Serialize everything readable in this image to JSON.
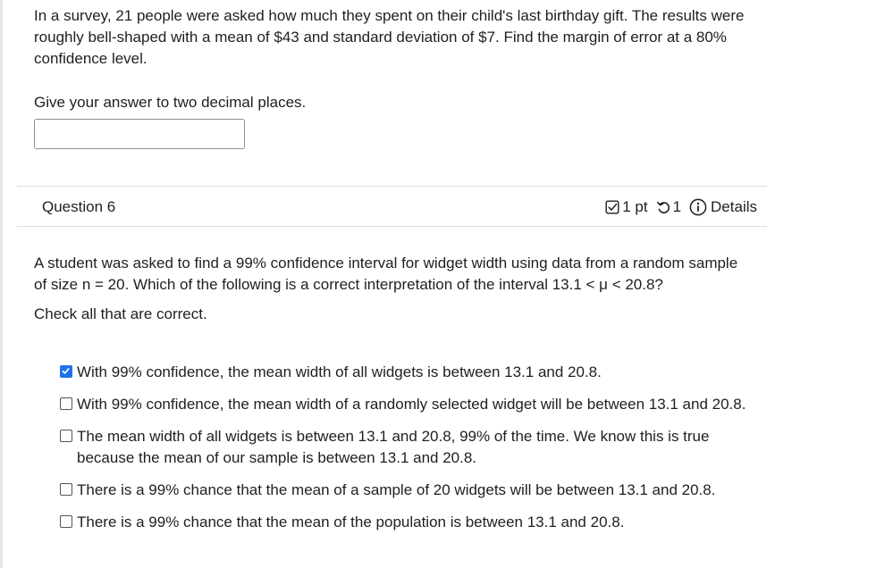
{
  "question5": {
    "prompt": "In a survey, 21 people were asked how much they spent on their child's last birthday gift. The results were roughly bell-shaped with a mean of $43 and standard deviation of $7. Find the margin of error at a 80% confidence level.",
    "instruction": "Give your answer to two decimal places.",
    "answer_value": ""
  },
  "question6": {
    "title": "Question 6",
    "points": "1 pt",
    "attempts": "1",
    "details_label": "Details",
    "prompt": "A student was asked to find a 99% confidence interval for widget width using data from a random sample of size n = 20. Which of the following is a correct interpretation of the interval 13.1 < μ < 20.8?",
    "check_all": "Check all that are correct.",
    "options": [
      {
        "label": "With 99% confidence, the mean width of all widgets is between 13.1 and 20.8.",
        "checked": true
      },
      {
        "label": "With 99% confidence, the mean width of a randomly selected widget will be between 13.1 and 20.8.",
        "checked": false
      },
      {
        "label": "The mean width of all widgets is between 13.1 and 20.8, 99% of the time. We know this is true because the mean of our sample is between 13.1 and 20.8.",
        "checked": false
      },
      {
        "label": "There is a 99% chance that the mean of a sample of 20 widgets will be between 13.1 and 20.8.",
        "checked": false
      },
      {
        "label": "There is a 99% chance that the mean of the population is between 13.1 and 20.8.",
        "checked": false
      }
    ]
  },
  "icons": {
    "points": "checkbox-icon",
    "attempts": "retry-icon",
    "details": "info-icon"
  },
  "colors": {
    "checked_box": "#1e73e8",
    "text": "#1f1f1f",
    "divider": "#dcdcdc"
  }
}
